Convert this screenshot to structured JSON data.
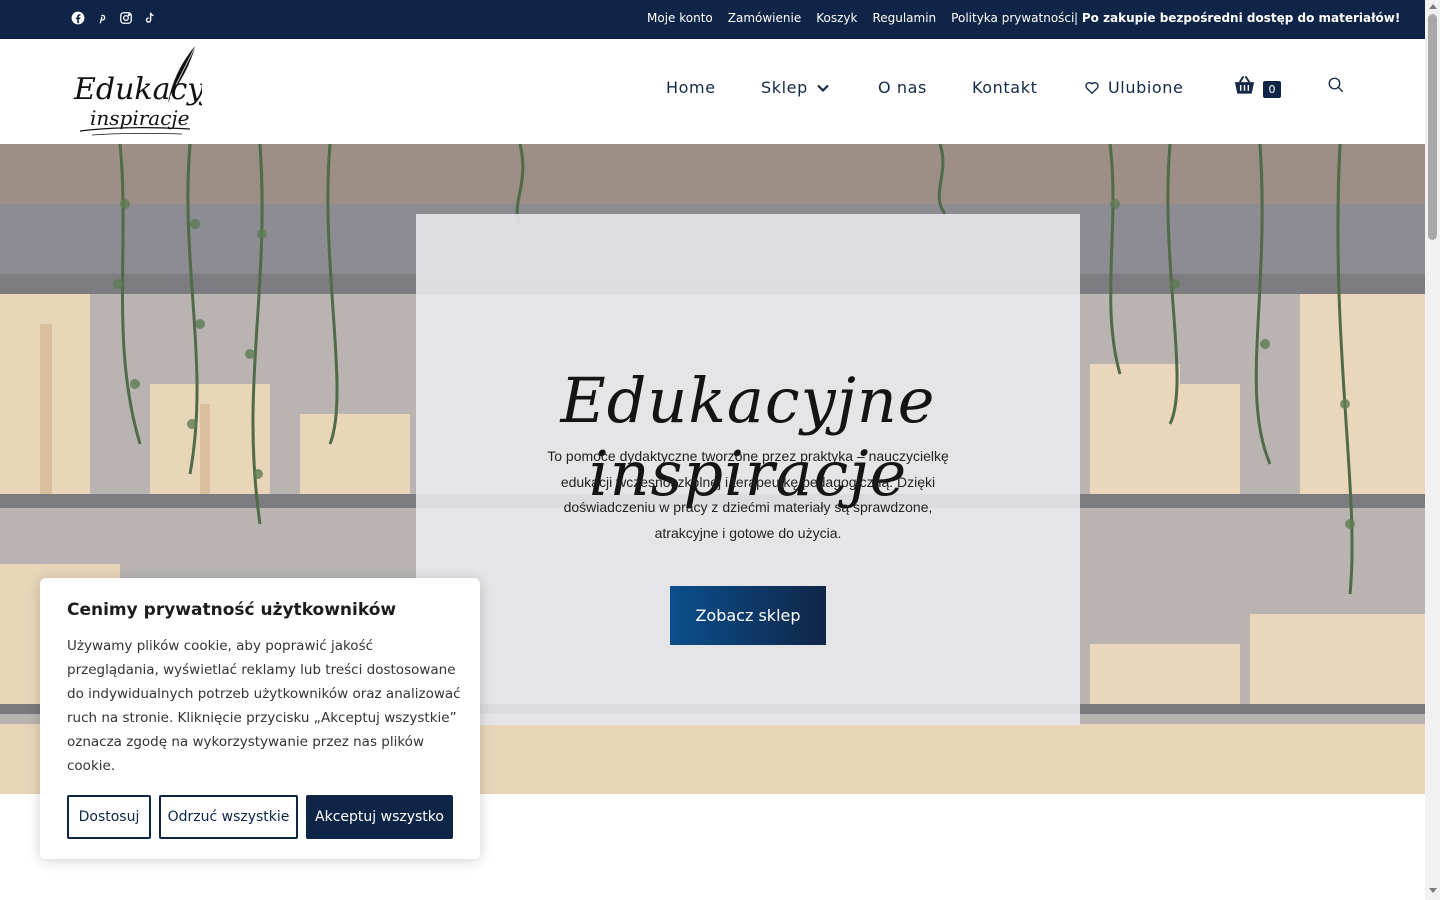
{
  "topbar": {
    "social": [
      "facebook-icon",
      "pinterest-icon",
      "instagram-icon",
      "tiktok-icon"
    ],
    "links": [
      "Moje konto",
      "Zamówienie",
      "Koszyk",
      "Regulamin",
      "Polityka prywatności"
    ],
    "note_prefix": "| ",
    "note": "Po zakupie bezpośredni dostęp do materiałów!"
  },
  "header": {
    "logo_line1": "Edukacyjne",
    "logo_line2": "inspiracje",
    "nav": {
      "home": "Home",
      "shop": "Sklep",
      "about": "O nas",
      "contact": "Kontakt",
      "favorites": "Ulubione"
    },
    "cart_count": "0"
  },
  "hero": {
    "title": "Edukacyjne inspiracje",
    "text": "To pomoce dydaktyczne tworzone przez praktyka – nauczycielkę edukacji wczesnoszkolnej i terapeutkę pedagogiczną. Dzięki doświadczeniu w pracy z dziećmi materiały są sprawdzone, atrakcyjne i gotowe do użycia.",
    "cta": "Zobacz sklep"
  },
  "cookie": {
    "title": "Cenimy prywatność użytkowników",
    "body": "Używamy plików cookie, aby poprawić jakość przeglądania, wyświetlać reklamy lub treści dostosowane do indywidualnych potrzeb użytkowników oraz analizować ruch na stronie. Kliknięcie przycisku „Akceptuj wszystkie” oznacza zgodę na wykorzystywanie przez nas plików cookie.",
    "customize": "Dostosuj",
    "reject": "Odrzuć wszystkie",
    "accept": "Akceptuj wszystko"
  },
  "colors": {
    "navy": "#0f2548",
    "cta_start": "#0b4f8c"
  }
}
